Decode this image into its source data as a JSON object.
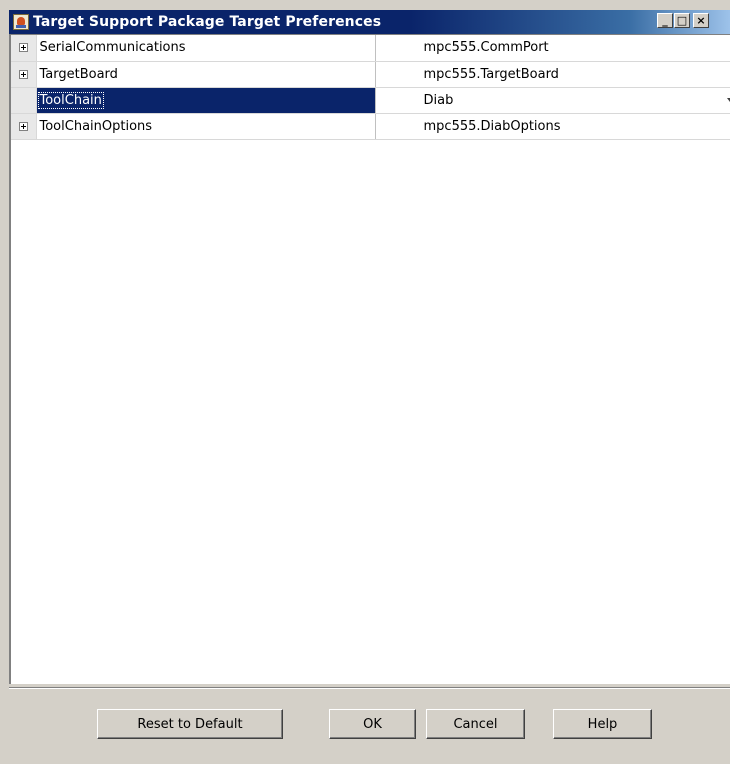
{
  "window": {
    "title": "Target Support Package Target Preferences",
    "minimize_glyph": "_",
    "maximize_glyph": "□",
    "close_glyph": "×"
  },
  "properties": [
    {
      "name": "SerialCommunications",
      "value": "mpc555.CommPort",
      "expandable": true,
      "selected": false
    },
    {
      "name": "TargetBoard",
      "value": "mpc555.TargetBoard",
      "expandable": true,
      "selected": false
    },
    {
      "name": "ToolChain",
      "value": "Diab",
      "expandable": false,
      "selected": true,
      "dropdown": true
    },
    {
      "name": "ToolChainOptions",
      "value": "mpc555.DiabOptions",
      "expandable": true,
      "selected": false
    }
  ],
  "buttons": {
    "reset": "Reset to Default",
    "ok": "OK",
    "cancel": "Cancel",
    "help": "Help"
  },
  "icons": {
    "app": "java-app-icon",
    "expand": "plus-box-icon",
    "dropdown": "chevron-down-icon"
  },
  "colors": {
    "titlebar": "#0a246a",
    "selection": "#0a246a",
    "chrome": "#d4d0c8"
  }
}
